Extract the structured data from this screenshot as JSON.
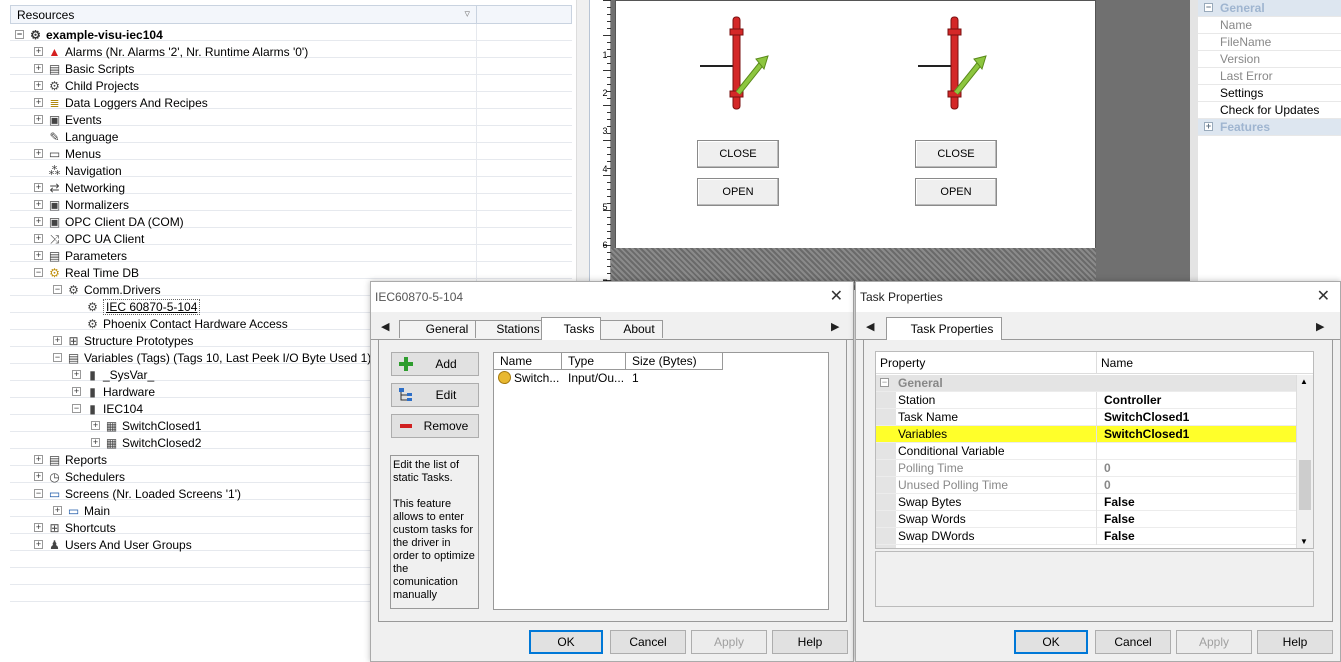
{
  "resources": {
    "header": "Resources",
    "tree": [
      {
        "label": "example-visu-iec104",
        "icon": "gear-icon",
        "expand": "-",
        "bold": true
      },
      {
        "label": "Alarms (Nr. Alarms '2', Nr. Runtime Alarms '0')",
        "icon": "alarm-bell-icon",
        "expand": "+"
      },
      {
        "label": "Basic Scripts",
        "icon": "script-icon",
        "expand": "+"
      },
      {
        "label": "Child Projects",
        "icon": "child-projects-icon",
        "expand": "+"
      },
      {
        "label": "Data Loggers And Recipes",
        "icon": "database-icon",
        "expand": "+"
      },
      {
        "label": "Events",
        "icon": "events-icon",
        "expand": "+"
      },
      {
        "label": "Language",
        "icon": "language-icon",
        "expand": ""
      },
      {
        "label": "Menus",
        "icon": "menu-icon",
        "expand": "+"
      },
      {
        "label": "Navigation",
        "icon": "navigation-icon",
        "expand": ""
      },
      {
        "label": "Networking",
        "icon": "network-icon",
        "expand": "+"
      },
      {
        "label": "Normalizers",
        "icon": "normalizer-icon",
        "expand": "+"
      },
      {
        "label": "OPC Client DA (COM)",
        "icon": "opc-da-icon",
        "expand": "+"
      },
      {
        "label": "OPC UA Client",
        "icon": "opc-ua-icon",
        "expand": "+"
      },
      {
        "label": "Parameters",
        "icon": "parameters-icon",
        "expand": "+"
      },
      {
        "label": "Real Time DB",
        "icon": "realtime-db-icon",
        "expand": "-"
      },
      {
        "label": "Comm.Drivers",
        "icon": "driver-icon",
        "expand": "-"
      },
      {
        "label": "IEC 60870-5-104",
        "icon": "driver-icon",
        "expand": "",
        "selected": true
      },
      {
        "label": "Phoenix Contact Hardware Access",
        "icon": "driver-icon",
        "expand": ""
      },
      {
        "label": "Structure Prototypes",
        "icon": "structure-icon",
        "expand": "+"
      },
      {
        "label": "Variables (Tags) (Tags 10, Last Peek I/O Byte Used 1)",
        "icon": "variables-icon",
        "expand": "-"
      },
      {
        "label": "_SysVar_",
        "icon": "folder-icon",
        "expand": "+"
      },
      {
        "label": "Hardware",
        "icon": "folder-icon",
        "expand": "+"
      },
      {
        "label": "IEC104",
        "icon": "folder-icon",
        "expand": "-"
      },
      {
        "label": "SwitchClosed1",
        "icon": "tag-icon",
        "expand": "+"
      },
      {
        "label": "SwitchClosed2",
        "icon": "tag-icon",
        "expand": "+"
      },
      {
        "label": "Reports",
        "icon": "reports-icon",
        "expand": "+"
      },
      {
        "label": "Schedulers",
        "icon": "scheduler-icon",
        "expand": "+"
      },
      {
        "label": "Screens (Nr. Loaded Screens '1')",
        "icon": "screens-icon",
        "expand": "-"
      },
      {
        "label": "Main",
        "icon": "screen-icon",
        "expand": "+"
      },
      {
        "label": "Shortcuts",
        "icon": "shortcuts-icon",
        "expand": "+"
      },
      {
        "label": "Users And User Groups",
        "icon": "users-icon",
        "expand": "+"
      }
    ]
  },
  "editor": {
    "ruler": [
      "1",
      "2",
      "3",
      "4",
      "5",
      "6",
      "7"
    ],
    "buttons": {
      "close": "CLOSE",
      "open": "OPEN"
    }
  },
  "right_props": {
    "group_general": "General",
    "items": [
      "Name",
      "FileName",
      "Version",
      "Last Error",
      "Settings",
      "Check for Updates"
    ],
    "group_features": "Features"
  },
  "iec_dialog": {
    "title": "IEC60870-5-104",
    "tabs": [
      "General",
      "Stations",
      "Tasks",
      "About"
    ],
    "active_tab": "Tasks",
    "add": "Add",
    "edit": "Edit",
    "remove": "Remove",
    "description": "Edit the list of static Tasks.\n\nThis feature allows to enter custom tasks for the driver in order to optimize the comunication manually",
    "columns": [
      "Name",
      "Type",
      "Size (Bytes)"
    ],
    "rows": [
      {
        "name": "Switch...",
        "type": "Input/Ou...",
        "size": "1"
      }
    ],
    "ok": "OK",
    "cancel": "Cancel",
    "apply": "Apply",
    "help": "Help"
  },
  "task_dialog": {
    "title": "Task Properties",
    "tab": "Task Properties",
    "col_property": "Property",
    "col_name": "Name",
    "group": "General",
    "rows": [
      {
        "name": "Station",
        "value": "Controller"
      },
      {
        "name": "Task Name",
        "value": "SwitchClosed1"
      },
      {
        "name": "Variables",
        "value": "SwitchClosed1",
        "highlight": true
      },
      {
        "name": "Conditional Variable",
        "value": ""
      },
      {
        "name": "Polling Time",
        "value": "0",
        "gray": true
      },
      {
        "name": "Unused Polling Time",
        "value": "0",
        "gray": true
      },
      {
        "name": "Swap Bytes",
        "value": "False"
      },
      {
        "name": "Swap Words",
        "value": "False"
      },
      {
        "name": "Swap DWords",
        "value": "False"
      }
    ],
    "ok": "OK",
    "cancel": "Cancel",
    "apply": "Apply",
    "help": "Help"
  },
  "colors": {
    "highlight": "#ffff2a",
    "valve_red": "#d42828",
    "valve_green": "#8dc63f",
    "accent": "#0078d7"
  }
}
